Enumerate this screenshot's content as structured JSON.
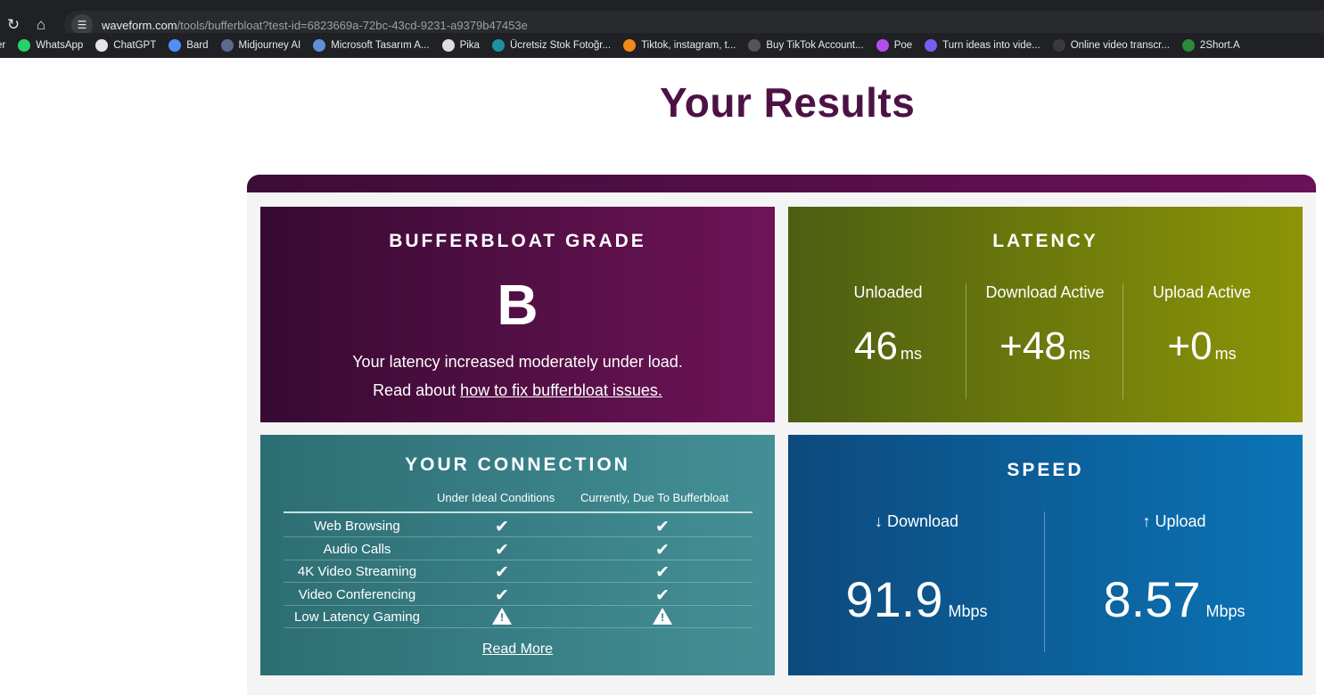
{
  "browser": {
    "url_host": "waveform.com",
    "url_path": "/tools/bufferbloat?test-id=6823669a-72bc-43cd-9231-a9379b47453e",
    "reload_icon": "reload-icon",
    "home_icon": "home-icon",
    "site_info_icon": "site-info-icon",
    "bookmarks": [
      {
        "label": "er",
        "icon": "bookmark-icon",
        "color": "#202124"
      },
      {
        "label": "WhatsApp",
        "icon": "whatsapp-icon",
        "color": "#25d366"
      },
      {
        "label": "ChatGPT",
        "icon": "chatgpt-icon",
        "color": "#e5e5e5"
      },
      {
        "label": "Bard",
        "icon": "bard-icon",
        "color": "#4f8ff7"
      },
      {
        "label": "Midjourney AI",
        "icon": "midjourney-icon",
        "color": "#5b6c8f"
      },
      {
        "label": "Microsoft Tasarım A...",
        "icon": "search-icon",
        "color": "#5f8fd6"
      },
      {
        "label": "Pika",
        "icon": "pika-icon",
        "color": "#dddddd"
      },
      {
        "label": "Ücretsiz Stok Fotoğr...",
        "icon": "stock-photo-icon",
        "color": "#1e90a0"
      },
      {
        "label": "Tiktok, instagram, t...",
        "icon": "tiktok-tools-icon",
        "color": "#f08a1c"
      },
      {
        "label": "Buy TikTok Account...",
        "icon": "tiktok-account-icon",
        "color": "#555555"
      },
      {
        "label": "Poe",
        "icon": "poe-icon",
        "color": "#b54cf0"
      },
      {
        "label": "Turn ideas into vide...",
        "icon": "video-ideas-icon",
        "color": "#7a5cf0"
      },
      {
        "label": "Online video transcr...",
        "icon": "transcribe-icon",
        "color": "#3a3a3a"
      },
      {
        "label": "2Short.A",
        "icon": "short-ai-icon",
        "color": "#2a8a3a"
      }
    ]
  },
  "page": {
    "title": "Your Results"
  },
  "grade": {
    "title": "BUFFERBLOAT GRADE",
    "letter": "B",
    "description": "Your latency increased moderately under load.",
    "link_prefix": "Read about ",
    "link_text": "how to fix bufferbloat issues.",
    "color_start": "#360a32",
    "color_end": "#6e1457"
  },
  "latency": {
    "title": "LATENCY",
    "columns": [
      {
        "label": "Unloaded",
        "value": "46",
        "unit": "ms"
      },
      {
        "label": "Download Active",
        "value": "+48",
        "unit": "ms"
      },
      {
        "label": "Upload Active",
        "value": "+0",
        "unit": "ms"
      }
    ]
  },
  "connection": {
    "title": "YOUR CONNECTION",
    "header_ideal": "Under Ideal Conditions",
    "header_current": "Currently, Due To Bufferbloat",
    "rows": [
      {
        "label": "Web Browsing",
        "ideal": "check",
        "current": "check"
      },
      {
        "label": "Audio Calls",
        "ideal": "check",
        "current": "check"
      },
      {
        "label": "4K Video Streaming",
        "ideal": "check",
        "current": "check"
      },
      {
        "label": "Video Conferencing",
        "ideal": "check",
        "current": "check"
      },
      {
        "label": "Low Latency Gaming",
        "ideal": "warning",
        "current": "warning"
      }
    ],
    "read_more": "Read More"
  },
  "speed": {
    "title": "SPEED",
    "download_label": "↓ Download",
    "download_value": "91.9",
    "download_unit": "Mbps",
    "upload_label": "↑ Upload",
    "upload_value": "8.57",
    "upload_unit": "Mbps"
  }
}
